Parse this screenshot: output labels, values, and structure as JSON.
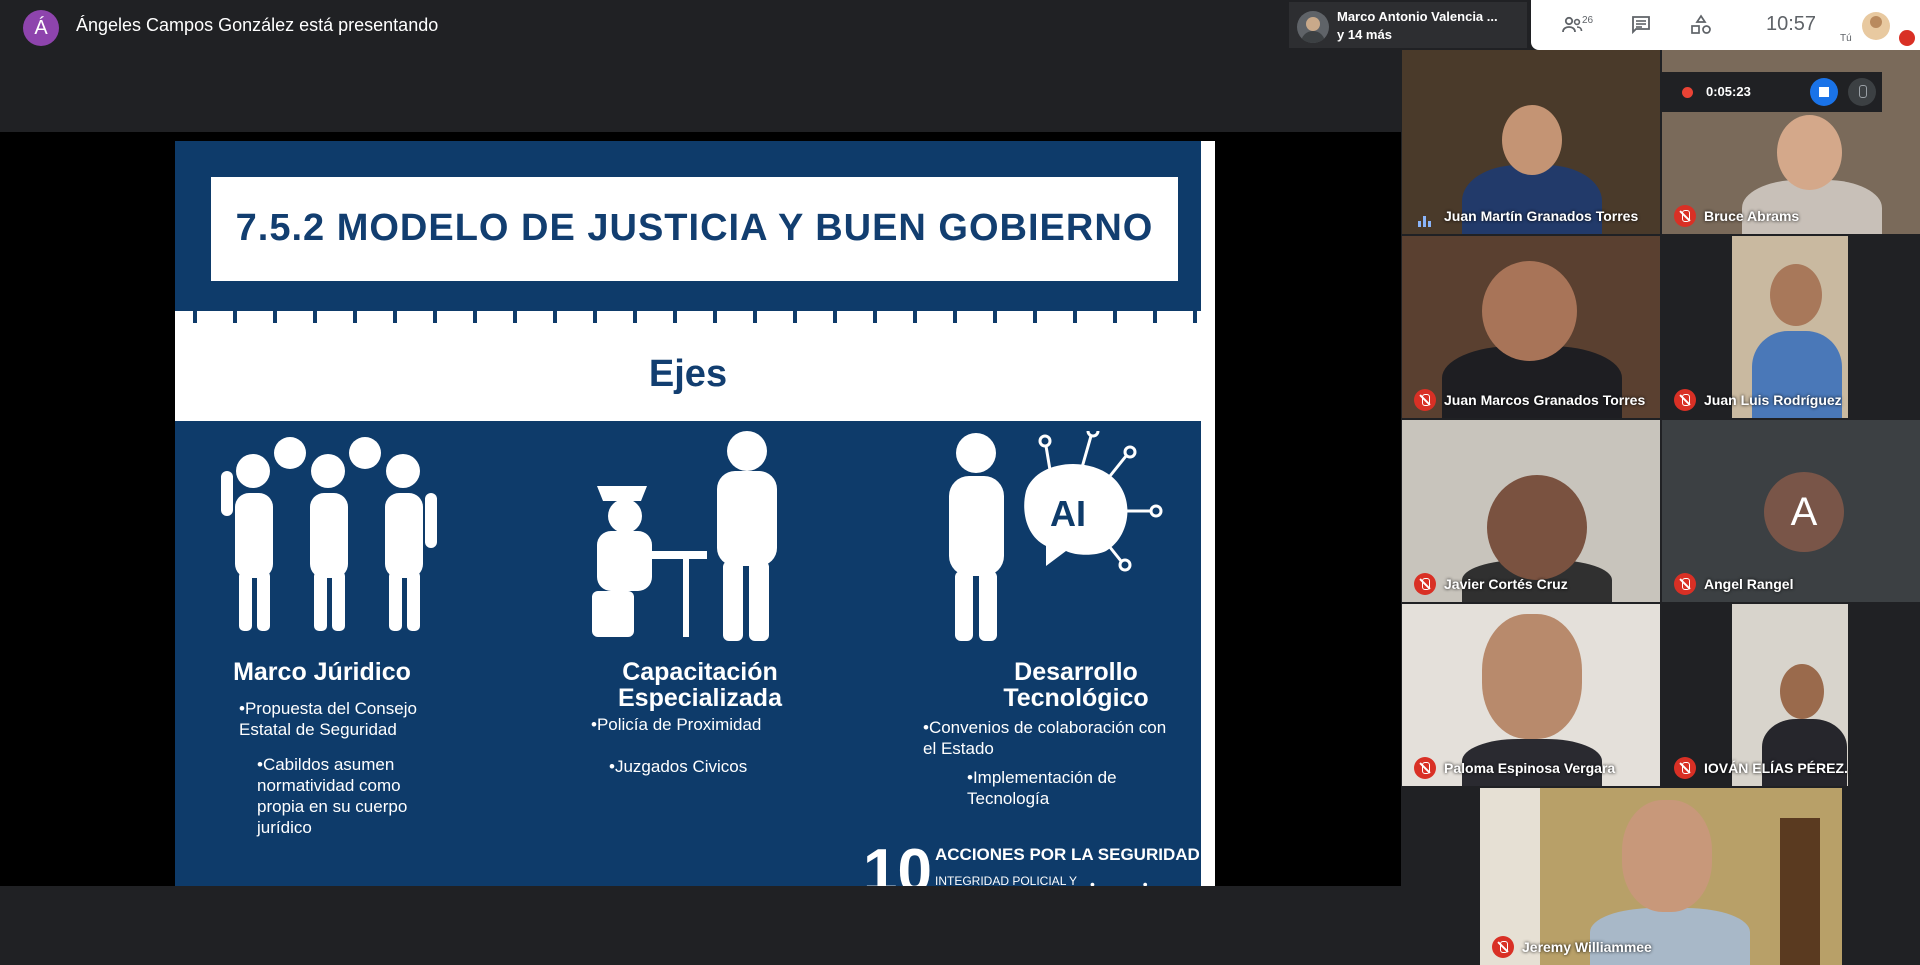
{
  "presenter": {
    "initial": "Á",
    "text": "Ángeles Campos González está presentando"
  },
  "others_chip": {
    "name": "Marco Antonio Valencia ...",
    "more": "y 14 más"
  },
  "toolbar": {
    "people_count": "26",
    "clock": "10:57",
    "self_label": "Tú"
  },
  "recording": {
    "time": "0:05:23"
  },
  "slide": {
    "title": "7.5.2 MODELO DE JUSTICIA Y BUEN GOBIERNO",
    "subtitle": "Ejes",
    "columns": [
      {
        "heading_lines": [
          "Marco Júridico"
        ],
        "bullets": [
          "•Propuesta del Consejo Estatal de Seguridad",
          "•Cabildos asumen normatividad como propia en su cuerpo jurídico"
        ]
      },
      {
        "heading_lines": [
          "Capacitación",
          "Especializada"
        ],
        "bullets": [
          "•Policía de Proximidad",
          "•Juzgados Civicos"
        ]
      },
      {
        "heading_lines": [
          "Desarrollo",
          "Tecnológico"
        ],
        "bullets": [
          "•Convenios de colaboración con el Estado",
          "•Implementación de Tecnología"
        ]
      }
    ],
    "ai_label": "AI",
    "acciones_num": "10",
    "acciones_title": "ACCIONES POR LA SEGURIDAD",
    "acciones_sub": "INTEGRIDAD POLICIAL Y",
    "dots": "• • • •"
  },
  "participants": [
    {
      "name": "Juan Martín Granados Torres",
      "muted": false
    },
    {
      "name": "Bruce Abrams",
      "muted": true
    },
    {
      "name": "Juan Marcos Granados Torres",
      "muted": true
    },
    {
      "name": "Juan Luis Rodríguez",
      "muted": true
    },
    {
      "name": "Javier Cortés Cruz",
      "muted": true
    },
    {
      "name": "Angel Rangel",
      "muted": true,
      "avatar_letter": "A"
    },
    {
      "name": "Paloma Espinosa Vergara",
      "muted": true
    },
    {
      "name": "IOVÁN ELÍAS PÉREZ.",
      "muted": true
    },
    {
      "name": "Jeremy Williammee",
      "muted": true
    }
  ],
  "colors": {
    "slide_blue": "#0e3b6a",
    "title_blue": "#123e70",
    "muted_red": "#d93025",
    "record_blue": "#1a73e8"
  }
}
